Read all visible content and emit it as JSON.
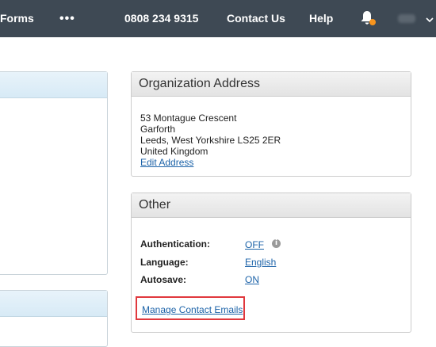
{
  "topbar": {
    "forms_label": "Forms",
    "more_label": "•••",
    "phone": "0808 234 9315",
    "contact_label": "Contact Us",
    "help_label": "Help",
    "user_initials": "AS"
  },
  "colors": {
    "topbar_bg": "#3e4954",
    "link": "#1b62a8",
    "notification_dot": "#f7941d",
    "highlight_border": "#e0383d"
  },
  "address_panel": {
    "title": "Organization Address",
    "lines": [
      "53 Montague Crescent",
      "Garforth",
      "Leeds, West Yorkshire LS25 2ER",
      "United Kingdom"
    ],
    "edit_link": "Edit Address"
  },
  "other_panel": {
    "title": "Other",
    "rows": [
      {
        "label": "Authentication:",
        "value": "OFF"
      },
      {
        "label": "Language:",
        "value": "English"
      },
      {
        "label": "Autosave:",
        "value": "ON"
      }
    ],
    "info_icon_glyph": "i",
    "manage_link": "Manage Contact Emails"
  },
  "icons": {
    "bell": "bell-icon",
    "info": "info-icon",
    "dropdown": "chevron-down-icon"
  }
}
